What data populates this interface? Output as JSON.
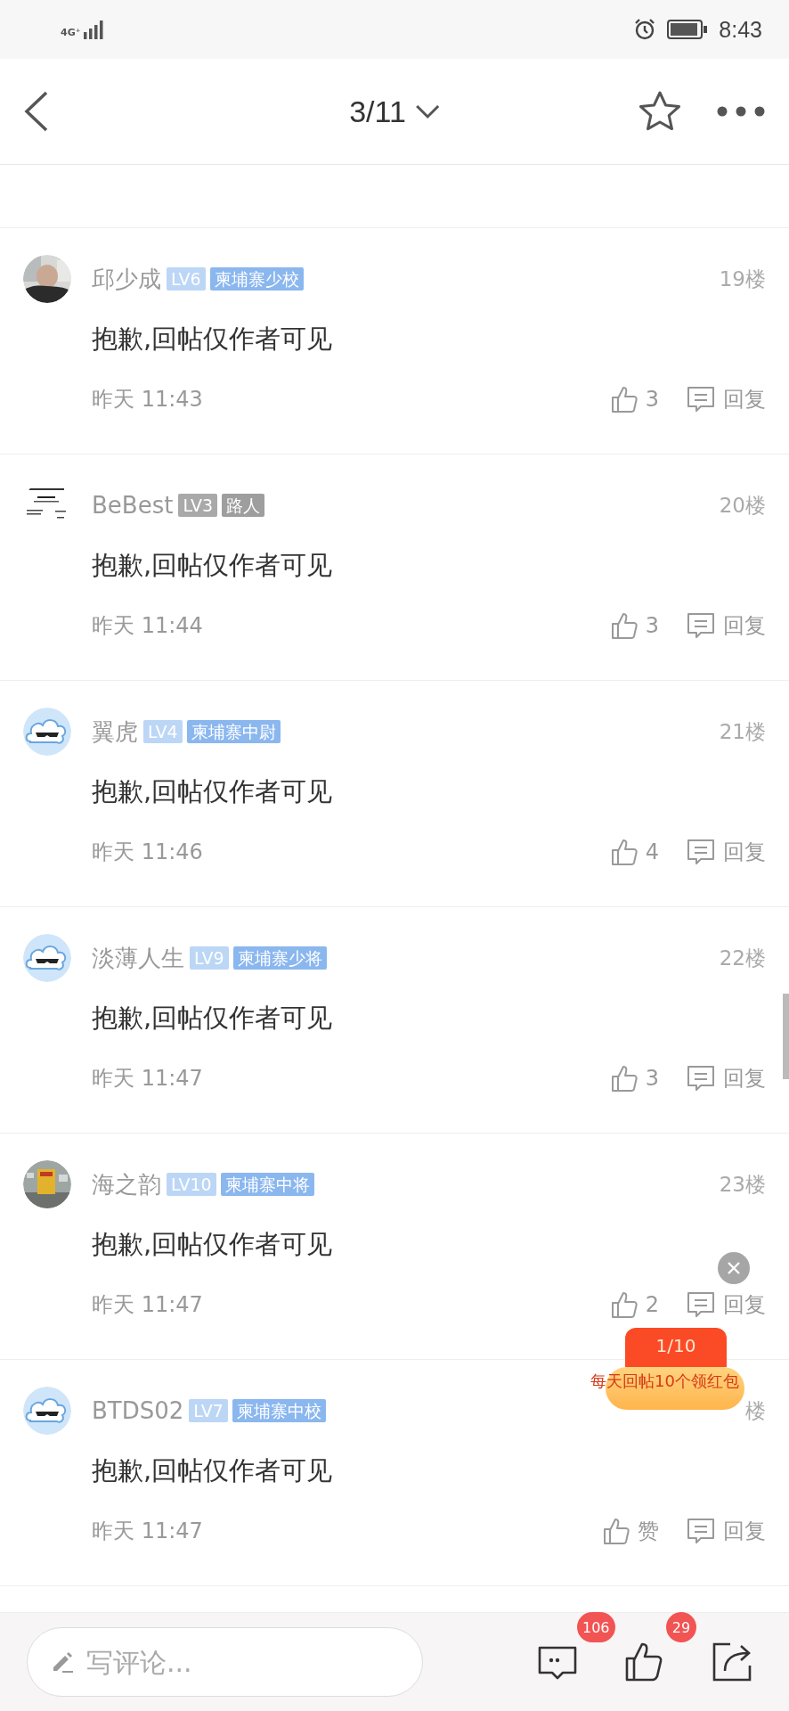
{
  "status_bar": {
    "network": "4G⁺",
    "time": "8:43"
  },
  "nav": {
    "title": "3/11"
  },
  "posts": [
    {
      "name": "邱少成",
      "tags": [
        {
          "text": "LV6",
          "color": "#bcd6f6"
        },
        {
          "text": "柬埔寨少校",
          "color": "#8bb7ef"
        }
      ],
      "floor": "19楼",
      "content": "抱歉,回帖仅作者可见",
      "time": "昨天 11:43",
      "likes": "3",
      "reply": "回复"
    },
    {
      "kind": "card",
      "name": "BeBest",
      "tags": [
        {
          "text": "LV3",
          "color": "#a9a9a9"
        },
        {
          "text": "路人",
          "color": "#9e9e9e"
        }
      ],
      "floor": "20楼",
      "content": "抱歉,回帖仅作者可见",
      "time": "昨天 11:44",
      "likes": "3",
      "reply": "回复"
    },
    {
      "kind": "cloud",
      "name": "翼虎",
      "tags": [
        {
          "text": "LV4",
          "color": "#bcd6f6"
        },
        {
          "text": "柬埔寨中尉",
          "color": "#8bb7ef"
        }
      ],
      "floor": "21楼",
      "content": "抱歉,回帖仅作者可见",
      "time": "昨天 11:46",
      "likes": "4",
      "reply": "回复"
    },
    {
      "kind": "cloud",
      "name": "淡薄人生",
      "tags": [
        {
          "text": "LV9",
          "color": "#bcd6f6"
        },
        {
          "text": "柬埔寨少将",
          "color": "#8bb7ef"
        }
      ],
      "floor": "22楼",
      "content": "抱歉,回帖仅作者可见",
      "time": "昨天 11:47",
      "likes": "3",
      "reply": "回复"
    },
    {
      "kind": "building",
      "name": "海之韵",
      "tags": [
        {
          "text": "LV10",
          "color": "#bcd6f6"
        },
        {
          "text": "柬埔寨中将",
          "color": "#8bb7ef"
        }
      ],
      "floor": "23楼",
      "content": "抱歉,回帖仅作者可见",
      "time": "昨天 11:47",
      "likes": "2",
      "reply": "回复"
    },
    {
      "kind": "cloud",
      "name": "BTDS02",
      "tags": [
        {
          "text": "LV7",
          "color": "#bcd6f6"
        },
        {
          "text": "柬埔寨中校",
          "color": "#8bb7ef"
        }
      ],
      "floor": "楼",
      "content": "抱歉,回帖仅作者可见",
      "time": "昨天 11:47",
      "likes": "赞",
      "reply": "回复"
    }
  ],
  "promo": {
    "progress": "1/10",
    "text": "每天回帖10个领红包"
  },
  "bottom_bar": {
    "placeholder": "写评论...",
    "comment_count": "106",
    "like_count": "29"
  }
}
